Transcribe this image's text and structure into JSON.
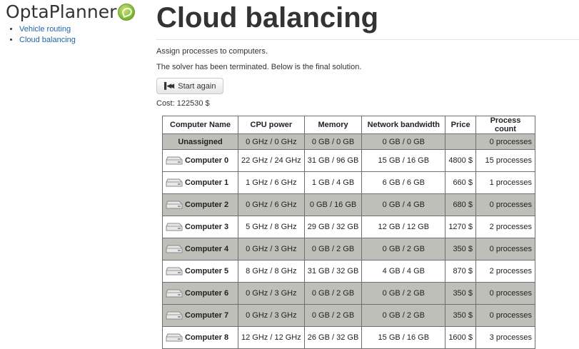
{
  "logo": {
    "text": "OptaPlanner"
  },
  "nav": [
    {
      "label": "Vehicle routing"
    },
    {
      "label": "Cloud balancing"
    }
  ],
  "page": {
    "title": "Cloud balancing",
    "description": "Assign processes to computers.",
    "status": "The solver has been terminated. Below is the final solution.",
    "start_button": "Start again",
    "cost": "Cost: 122530 $"
  },
  "table": {
    "headers": [
      "Computer Name",
      "CPU power",
      "Memory",
      "Network bandwidth",
      "Price",
      "Process count"
    ],
    "unassigned": {
      "name": "Unassigned",
      "cpu": "0 GHz / 0 GHz",
      "memory": "0 GB / 0 GB",
      "network": "0 GB / 0 GB",
      "price": "",
      "processes": "0 processes"
    },
    "rows": [
      {
        "name": "Computer 0",
        "cpu": "22 GHz / 24 GHz",
        "memory": "31 GB / 96 GB",
        "network": "15 GB / 16 GB",
        "price": "4800 $",
        "processes": "15 processes"
      },
      {
        "name": "Computer 1",
        "cpu": "1 GHz / 6 GHz",
        "memory": "1 GB / 4 GB",
        "network": "6 GB / 6 GB",
        "price": "660 $",
        "processes": "1 processes"
      },
      {
        "name": "Computer 2",
        "cpu": "0 GHz / 6 GHz",
        "memory": "0 GB / 16 GB",
        "network": "0 GB / 4 GB",
        "price": "680 $",
        "processes": "0 processes"
      },
      {
        "name": "Computer 3",
        "cpu": "5 GHz / 8 GHz",
        "memory": "29 GB / 32 GB",
        "network": "12 GB / 12 GB",
        "price": "1270 $",
        "processes": "2 processes"
      },
      {
        "name": "Computer 4",
        "cpu": "0 GHz / 3 GHz",
        "memory": "0 GB / 2 GB",
        "network": "0 GB / 2 GB",
        "price": "350 $",
        "processes": "0 processes"
      },
      {
        "name": "Computer 5",
        "cpu": "8 GHz / 8 GHz",
        "memory": "31 GB / 32 GB",
        "network": "4 GB / 4 GB",
        "price": "870 $",
        "processes": "2 processes"
      },
      {
        "name": "Computer 6",
        "cpu": "0 GHz / 3 GHz",
        "memory": "0 GB / 2 GB",
        "network": "0 GB / 2 GB",
        "price": "350 $",
        "processes": "0 processes"
      },
      {
        "name": "Computer 7",
        "cpu": "0 GHz / 3 GHz",
        "memory": "0 GB / 2 GB",
        "network": "0 GB / 2 GB",
        "price": "350 $",
        "processes": "0 processes"
      },
      {
        "name": "Computer 8",
        "cpu": "12 GHz / 12 GHz",
        "memory": "26 GB / 32 GB",
        "network": "15 GB / 16 GB",
        "price": "1600 $",
        "processes": "3 processes"
      }
    ]
  },
  "colors": {
    "unused_row": "#bfbfb9",
    "link": "#1f65a8",
    "brand_green": "#7ab12f"
  }
}
